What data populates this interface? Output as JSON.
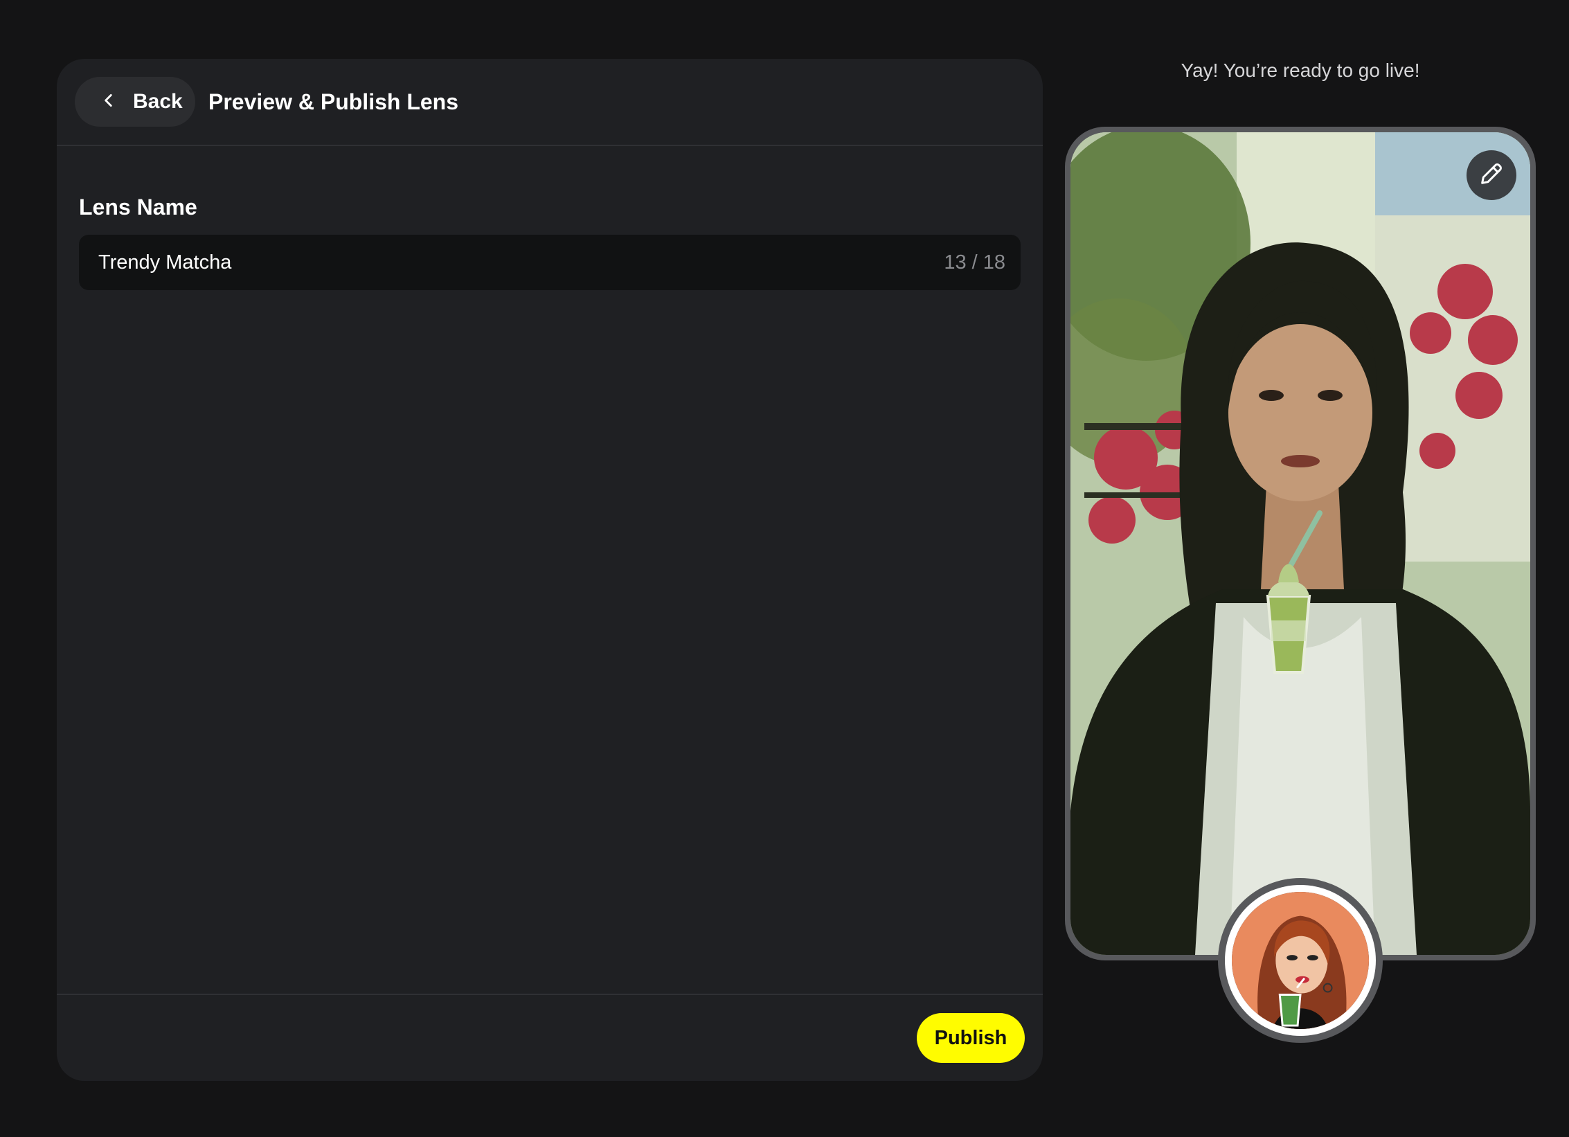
{
  "header": {
    "back_label": "Back",
    "title": "Preview & Publish Lens"
  },
  "lens_form": {
    "field_label": "Lens Name",
    "name_value": "Trendy Matcha",
    "char_count": "13 / 18"
  },
  "footer": {
    "publish_label": "Publish"
  },
  "preview": {
    "status_text": "Yay! You’re ready to go live!"
  },
  "icons": {
    "back": "chevron-left-icon",
    "edit": "pencil-icon"
  },
  "colors": {
    "accent": "#fffc00",
    "background": "#141415",
    "panel": "#1f2023"
  }
}
